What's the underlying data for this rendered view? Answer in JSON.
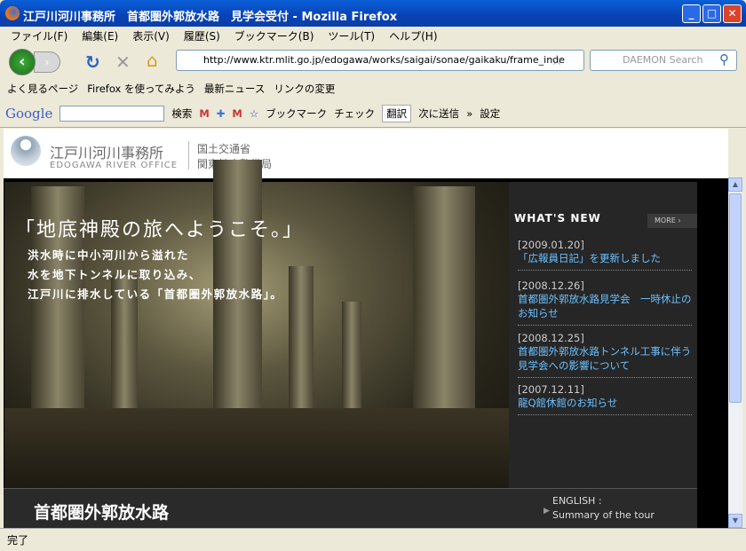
{
  "window": {
    "title": "江戸川河川事務所　首都圏外郭放水路　見学会受付 - Mozilla Firefox"
  },
  "menu": [
    "ファイル(F)",
    "編集(E)",
    "表示(V)",
    "履歴(S)",
    "ブックマーク(B)",
    "ツール(T)",
    "ヘルプ(H)"
  ],
  "nav": {
    "url": "http://www.ktr.mlit.go.jp/edogawa/works/saigai/sonae/gaikaku/frame_inde",
    "search_placeholder": "DAEMON Search"
  },
  "bookmarks": [
    "よく見るページ",
    "Firefox を使ってみよう",
    "最新ニュース",
    "リンクの変更"
  ],
  "google_toolbar": {
    "logo": "Google",
    "search": "検索",
    "bookmark": "ブックマーク",
    "check": "チェック",
    "translate": "翻訳",
    "send": "次に送信",
    "more": "»",
    "settings": "設定"
  },
  "page": {
    "org_name": "江戸川河川事務所",
    "org_en": "EDOGAWA RIVER OFFICE",
    "ministry1": "国土交通省",
    "ministry2": "関東地方整備局",
    "catch": "「地底神殿の旅へようこそ。」",
    "sub": [
      "洪水時に中小河川から溢れた",
      "水を地下トンネルに取り込み、",
      "江戸川に排水している「首都圏外郭放水路」。"
    ],
    "whats_new": "WHAT'S NEW",
    "more": "MORE",
    "news": [
      {
        "date": "[2009.01.20]",
        "text": "「広報員日記」を更新しました"
      },
      {
        "date": "[2008.12.26]",
        "text": "首都圏外郭放水路見学会　一時休止のお知らせ"
      },
      {
        "date": "[2008.12.25]",
        "text": "首都圏外郭放水路トンネル工事に伴う見学会への影響について"
      },
      {
        "date": "[2007.12.11]",
        "text": "龍Q館休館のお知らせ"
      }
    ],
    "bottom_title": "首都圏外郭放水路",
    "english_label": "ENGLISH :",
    "english_link": "Summary of the tour"
  },
  "status": "完了"
}
